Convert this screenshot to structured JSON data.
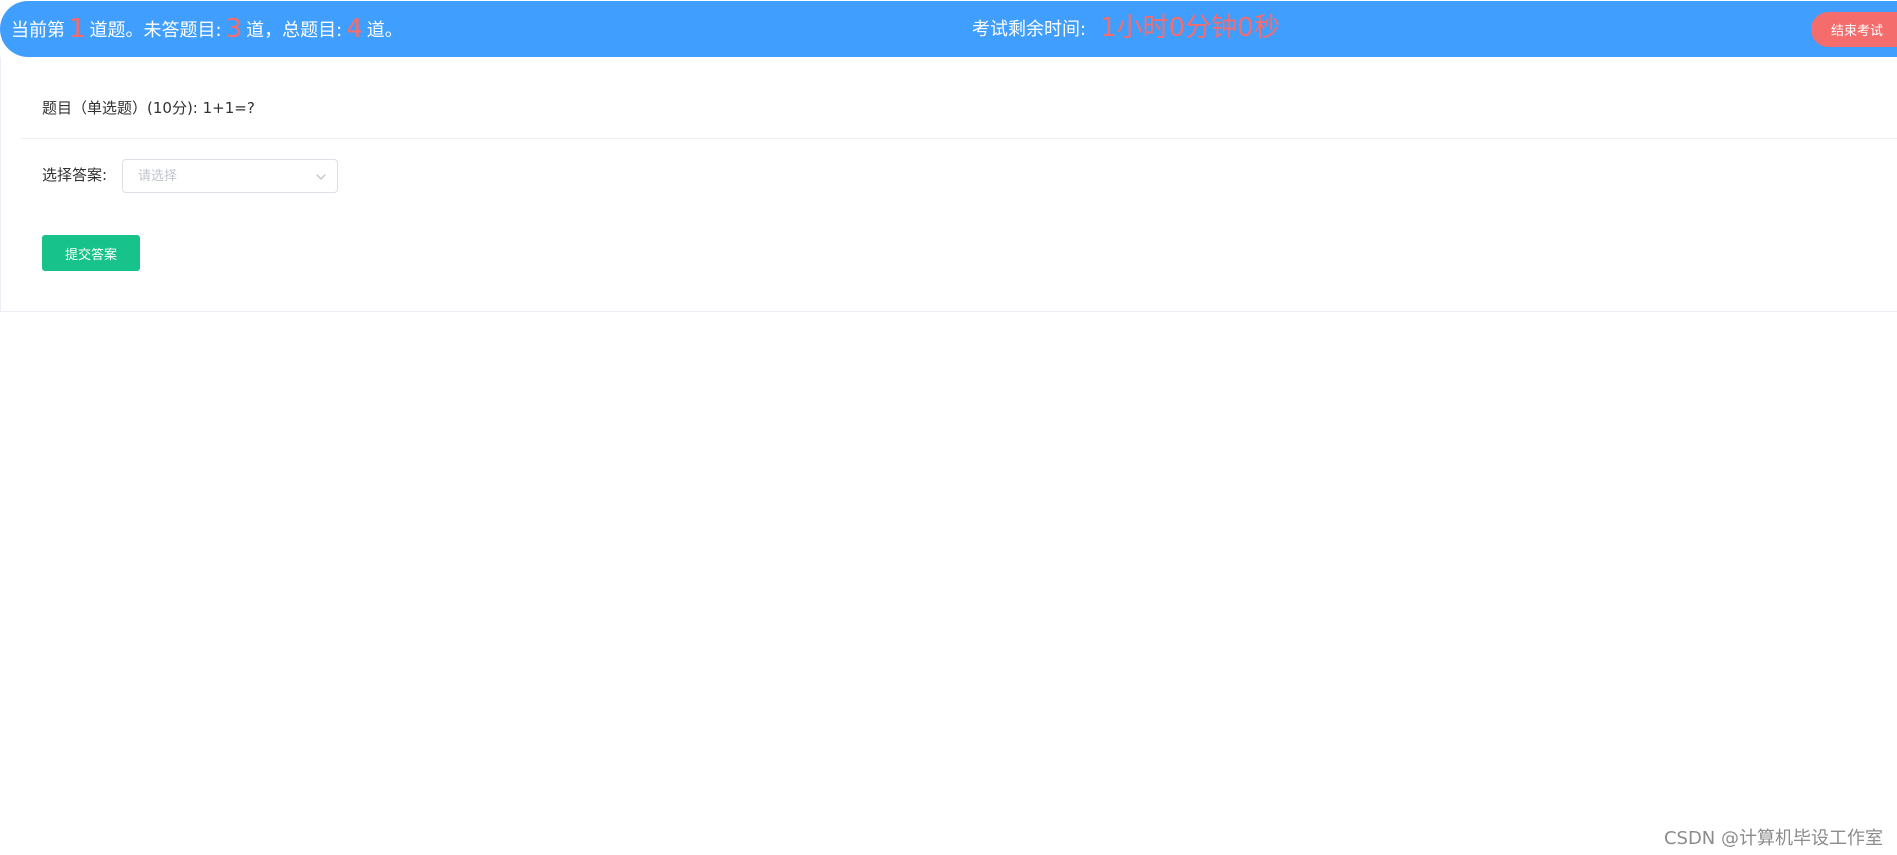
{
  "status_bar": {
    "progress": {
      "prefix": "当前第",
      "current": "1",
      "after_current": "道题。未答题目:",
      "unanswered": "3",
      "after_unanswered": "道，总题目:",
      "total": "4",
      "suffix": "道。"
    },
    "timer": {
      "label": "考试剩余时间:",
      "value": "1小时0分钟0秒"
    },
    "end_button_label": "结束考试"
  },
  "question": {
    "text": "题目（单选题）(10分):  1+1=?"
  },
  "answer": {
    "label": "选择答案:",
    "select_placeholder": "请选择",
    "select_value": ""
  },
  "submit_button_label": "提交答案",
  "watermark": "CSDN @计算机毕设工作室",
  "colors": {
    "header_background": "#409eff",
    "highlight_number": "#f56c6c",
    "end_button": "#f56c6c",
    "submit_button": "#17c38a"
  }
}
